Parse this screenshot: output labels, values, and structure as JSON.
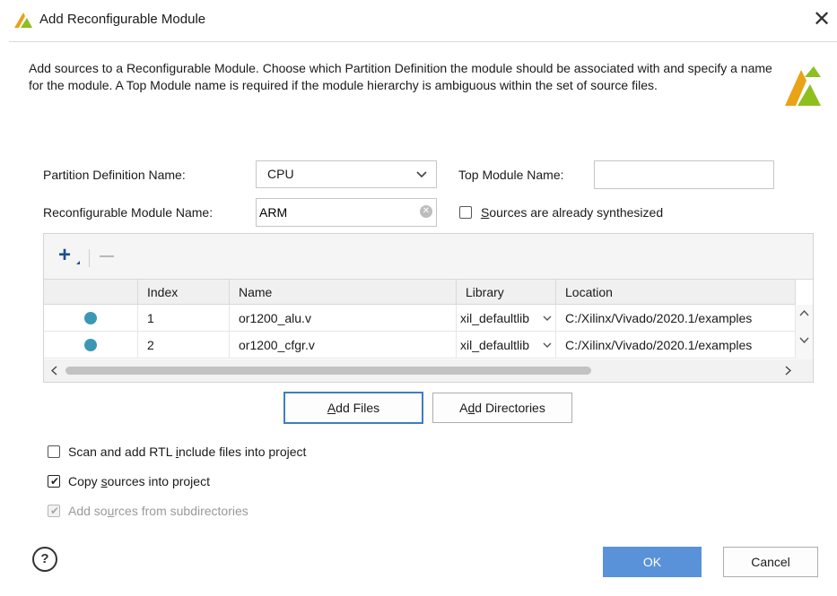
{
  "window": {
    "title": "Add Reconfigurable Module",
    "close_glyph": "✕",
    "logo_icon": "xilinx-logo-icon"
  },
  "description": "Add sources to a Reconfigurable Module. Choose which Partition Definition the module should be associated with and specify a name for the module. A Top Module name is required if the module hierarchy is ambiguous within the set of source files.",
  "form": {
    "partition_label": "Partition Definition Name:",
    "partition_value": "CPU",
    "top_module_label": "Top Module Name:",
    "top_module_value": "",
    "rm_name_label": "Reconfigurable Module Name:",
    "rm_name_value": "ARM",
    "synth_label_pre": "",
    "synth_label_mnemonic": "S",
    "synth_label_post": "ources are already synthesized",
    "synth_checked": false
  },
  "files_table": {
    "toolbar": {
      "add_icon": "plus-icon",
      "remove_icon": "minus-icon"
    },
    "columns": [
      "",
      "Index",
      "Name",
      "Library",
      "Location"
    ],
    "rows": [
      {
        "status_icon": "source-dot-icon",
        "index": "1",
        "name": "or1200_alu.v",
        "library": "xil_defaultlib",
        "location": "C:/Xilinx/Vivado/2020.1/examples"
      },
      {
        "status_icon": "source-dot-icon",
        "index": "2",
        "name": "or1200_cfgr.v",
        "library": "xil_defaultlib",
        "location": "C:/Xilinx/Vivado/2020.1/examples"
      }
    ]
  },
  "buttons": {
    "add_files_mnemonic": "A",
    "add_files_rest": "dd Files",
    "add_dirs_pre": "A",
    "add_dirs_mnemonic": "d",
    "add_dirs_rest": "d Directories",
    "ok": "OK",
    "cancel": "Cancel"
  },
  "options": {
    "scan_pre": "Scan and add RTL ",
    "scan_mnemonic": "i",
    "scan_post": "nclude files into project",
    "scan_checked": false,
    "copy_pre": "Copy ",
    "copy_mnemonic": "s",
    "copy_post": "ources into project",
    "copy_checked": true,
    "subdirs_pre": "Add so",
    "subdirs_mnemonic": "u",
    "subdirs_post": "rces from subdirectories",
    "subdirs_checked": true,
    "subdirs_disabled": true
  },
  "help_glyph": "?",
  "colors": {
    "accent": "#5a92d9",
    "focus_border": "#3c7fc0",
    "status_dot": "#3b98b5",
    "xilinx_orange": "#e8a317",
    "xilinx_green": "#8fbf1f"
  }
}
